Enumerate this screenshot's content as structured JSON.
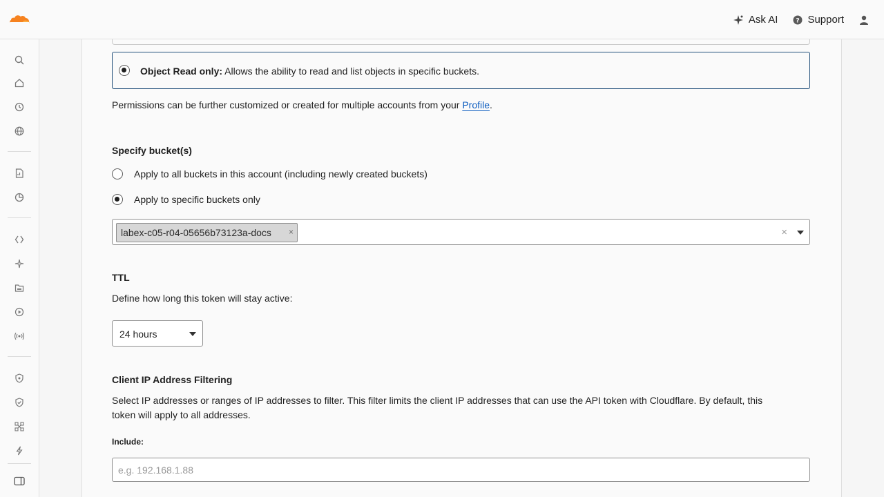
{
  "topbar": {
    "ask_ai": "Ask AI",
    "support": "Support"
  },
  "icons": {
    "logo": "cloudflare-logo",
    "sidebar": [
      "search-icon",
      "home-icon",
      "history-icon",
      "globe-icon",
      "document-chart-icon",
      "pie-chart-icon",
      "code-icon",
      "sparkle-icon",
      "folder-icon",
      "play-icon",
      "broadcast-icon",
      "shield-icon",
      "shield-check-icon",
      "network-icon",
      "bolt-icon",
      "panel-icon"
    ]
  },
  "permissions": {
    "option_label_bold": "Object Read only:",
    "option_label_rest": " Allows the ability to read and list objects in specific buckets.",
    "note_prefix": "Permissions can be further customized or created for multiple accounts from your ",
    "note_link": "Profile",
    "note_suffix": "."
  },
  "buckets": {
    "heading": "Specify bucket(s)",
    "option_all": "Apply to all buckets in this account (including newly created buckets)",
    "option_specific": "Apply to specific buckets only",
    "selected_chip": "labex-c05-r04-05656b73123a-docs",
    "chip_remove": "×",
    "clear": "×"
  },
  "ttl": {
    "heading": "TTL",
    "description": "Define how long this token will stay active:",
    "selected": "24 hours"
  },
  "ip_filter": {
    "heading": "Client IP Address Filtering",
    "description_line1": "Select IP addresses or ranges of IP addresses to filter. This filter limits the client IP addresses that can use the API token with Cloudflare. By default, this",
    "description_line2": "token will apply to all addresses.",
    "include_label": "Include:",
    "include_placeholder": "e.g. 192.168.1.88"
  }
}
